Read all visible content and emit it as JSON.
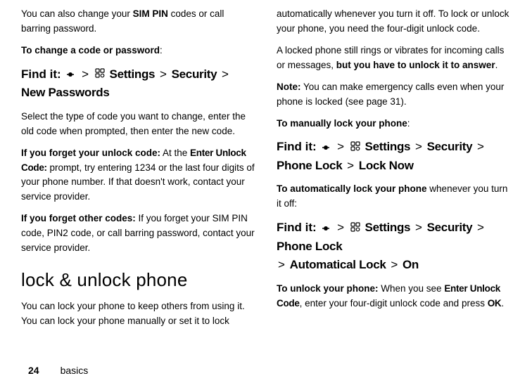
{
  "left": {
    "p1_a": "You can also change your ",
    "p1_b": "SIM PIN",
    "p1_c": " codes or call barring password.",
    "p2": "To change a code or password",
    "p2_colon": ":",
    "find_label": "Find it:",
    "path1": {
      "a": "Settings",
      "b": "Security",
      "c": "New Passwords"
    },
    "p3": "Select the type of code you want to change, enter the old code when prompted, then enter the new code.",
    "p4_bold": "If you forget your unlock code:",
    "p4_rest_a": " At the ",
    "p4_code": "Enter Unlock Code:",
    "p4_rest_b": " prompt, try entering 1234 or the last four digits of your phone number. If that doesn't work, contact your service provider.",
    "p5_bold": "If you forget other codes:",
    "p5_rest": " If you forget your SIM PIN code, PIN2 code, or call barring password, contact your service provider.",
    "heading": "lock & unlock phone",
    "p6": "You can lock your phone to keep others from using it. You can lock your phone manually or set it to lock"
  },
  "right": {
    "p1": "automatically whenever you turn it off. To lock or unlock your phone, you need the four-digit unlock code.",
    "p2_a": "A locked phone still rings or vibrates for incoming calls or messages, ",
    "p2_b": "but you have to unlock it to answer",
    "p2_c": ".",
    "p3_bold": "Note:",
    "p3_rest": " You can make emergency calls even when your phone is locked (see page 31).",
    "p4_bold": "To manually lock your phone",
    "p4_colon": ":",
    "find_label": "Find it:",
    "path2": {
      "a": "Settings",
      "b": "Security",
      "c": "Phone Lock",
      "d": "Lock Now"
    },
    "p5_bold": "To automatically lock your phone",
    "p5_rest": " whenever you turn it off:",
    "path3": {
      "a": "Settings",
      "b": "Security",
      "c": "Phone Lock",
      "d": "Automatical Lock",
      "e": "On"
    },
    "p6_bold": "To unlock your phone:",
    "p6_rest_a": " When you see ",
    "p6_code": "Enter Unlock Code",
    "p6_rest_b": ", enter your four-digit unlock code and press ",
    "p6_ok": "OK",
    "p6_rest_c": "."
  },
  "footer": {
    "page": "24",
    "section": "basics"
  },
  "gt": ">"
}
